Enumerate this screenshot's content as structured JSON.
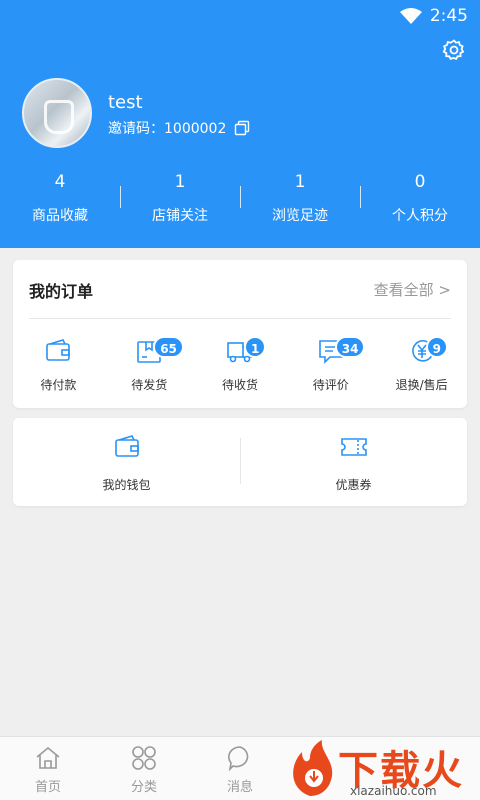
{
  "status_bar": {
    "time": "2:45"
  },
  "profile": {
    "username": "test",
    "invite_text": "邀请码：1000002"
  },
  "stats": [
    {
      "value": "4",
      "label": "商品收藏"
    },
    {
      "value": "1",
      "label": "店铺关注"
    },
    {
      "value": "1",
      "label": "浏览足迹"
    },
    {
      "value": "0",
      "label": "个人积分"
    }
  ],
  "orders": {
    "title": "我的订单",
    "view_all": "查看全部 >",
    "items": [
      {
        "label": "待付款",
        "icon": "wallet-icon",
        "badge": ""
      },
      {
        "label": "待发货",
        "icon": "package-icon",
        "badge": "65"
      },
      {
        "label": "待收货",
        "icon": "truck-icon",
        "badge": "1"
      },
      {
        "label": "待评价",
        "icon": "comment-icon",
        "badge": "34"
      },
      {
        "label": "退换/售后",
        "icon": "refund-icon",
        "badge": "9"
      }
    ]
  },
  "services": [
    {
      "label": "我的钱包",
      "icon": "wallet-icon"
    },
    {
      "label": "优惠券",
      "icon": "coupon-icon"
    }
  ],
  "tabbar": [
    {
      "label": "首页",
      "icon": "home-icon"
    },
    {
      "label": "分类",
      "icon": "category-icon"
    },
    {
      "label": "消息",
      "icon": "message-icon"
    }
  ],
  "watermark": {
    "brand": "下载火",
    "url": "xiazaihuo.com"
  },
  "colors": {
    "primary": "#2a93f7",
    "background": "#efefef",
    "watermark": "#e8491c"
  }
}
